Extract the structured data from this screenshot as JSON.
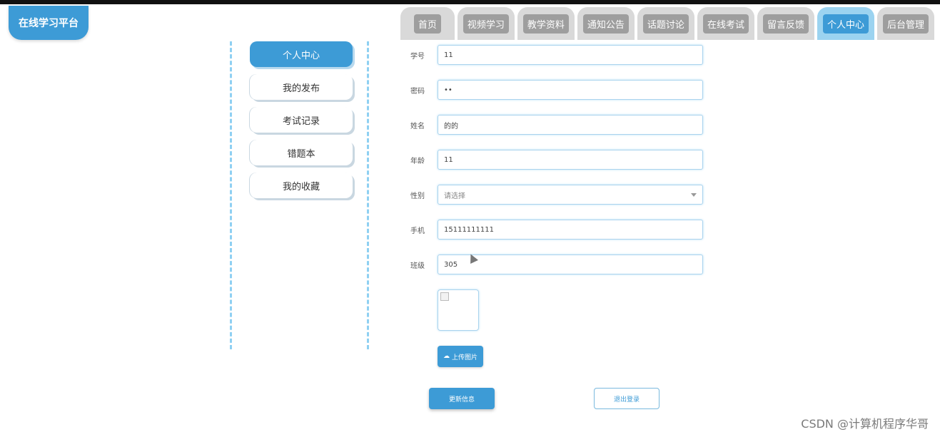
{
  "app": {
    "logo_text": "在线学习平台"
  },
  "nav": {
    "tabs": [
      {
        "label": "首页"
      },
      {
        "label": "视频学习"
      },
      {
        "label": "教学资料"
      },
      {
        "label": "通知公告"
      },
      {
        "label": "话题讨论"
      },
      {
        "label": "在线考试"
      },
      {
        "label": "留言反馈"
      },
      {
        "label": "个人中心",
        "active": true
      },
      {
        "label": "后台管理"
      }
    ]
  },
  "sidebar": {
    "items": [
      {
        "label": "个人中心",
        "active": true
      },
      {
        "label": "我的发布"
      },
      {
        "label": "考试记录"
      },
      {
        "label": "错题本"
      },
      {
        "label": "我的收藏"
      }
    ]
  },
  "form": {
    "student_id": {
      "label": "学号",
      "value": "11"
    },
    "password": {
      "label": "密码",
      "value": "••"
    },
    "name": {
      "label": "姓名",
      "value": "的的"
    },
    "age": {
      "label": "年龄",
      "value": "11"
    },
    "gender": {
      "label": "性别",
      "placeholder": "请选择"
    },
    "phone": {
      "label": "手机",
      "value": "15111111111"
    },
    "class": {
      "label": "班级",
      "value": "305"
    }
  },
  "buttons": {
    "upload": "上传图片",
    "update": "更新信息",
    "logout": "退出登录"
  },
  "watermark": "CSDN @计算机程序华哥",
  "colors": {
    "accent": "#3d9bd6",
    "tab_inactive": "#9e9e9e",
    "dashed_line": "#8fd0f2"
  }
}
